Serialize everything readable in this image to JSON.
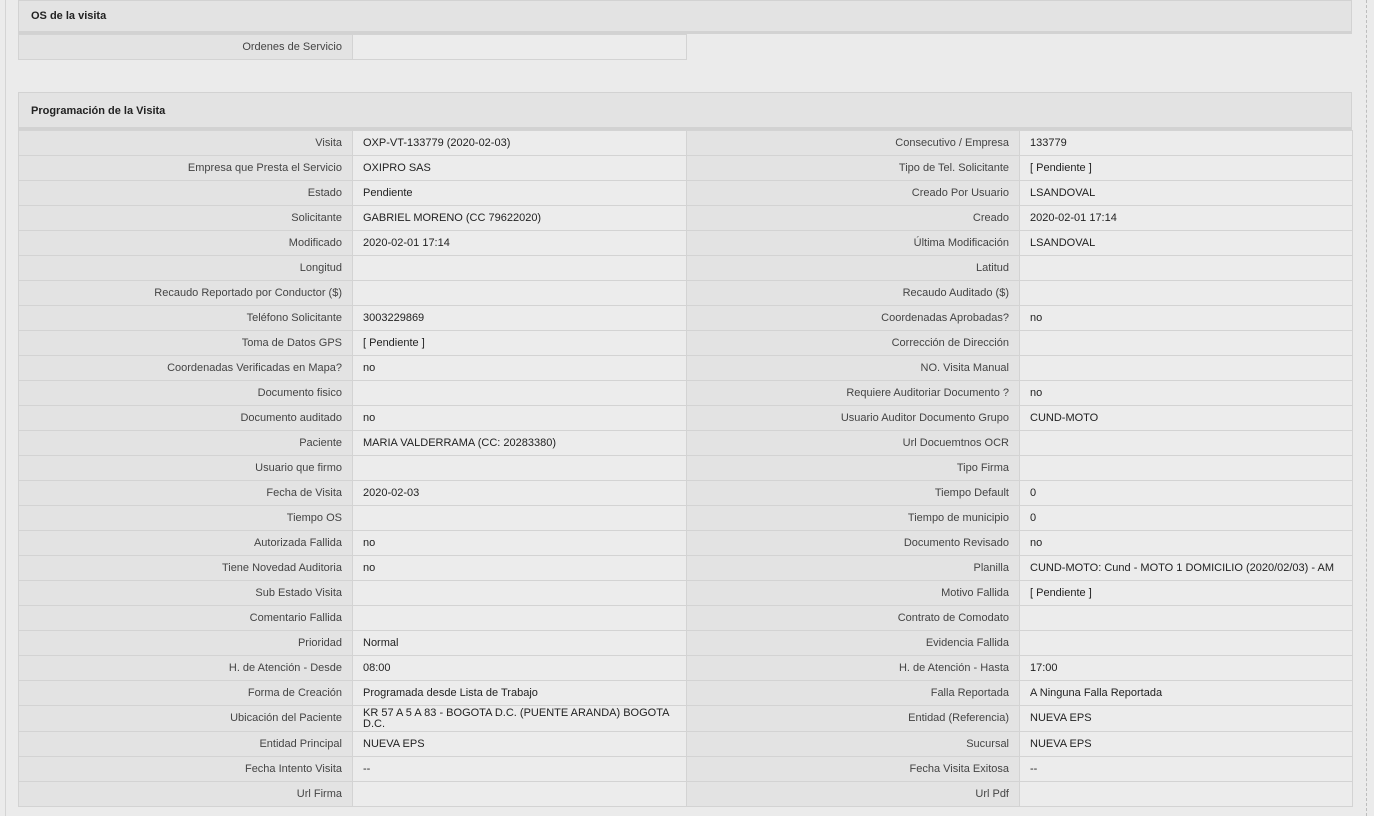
{
  "os_section": {
    "title": "OS de la visita",
    "rows": [
      {
        "label": "Ordenes de Servicio",
        "value": ""
      }
    ]
  },
  "program_section": {
    "title": "Programación de la Visita",
    "rows": [
      {
        "l1": "Visita",
        "v1": "OXP-VT-133779 (2020-02-03)",
        "l2": "Consecutivo / Empresa",
        "v2": "133779"
      },
      {
        "l1": "Empresa que Presta el Servicio",
        "v1": "OXIPRO SAS",
        "l2": "Tipo de Tel. Solicitante",
        "v2": "[ Pendiente ]"
      },
      {
        "l1": "Estado",
        "v1": "Pendiente",
        "l2": "Creado Por Usuario",
        "v2": "LSANDOVAL"
      },
      {
        "l1": "Solicitante",
        "v1": "GABRIEL MORENO (CC 79622020)",
        "l2": "Creado",
        "v2": "2020-02-01 17:14"
      },
      {
        "l1": "Modificado",
        "v1": "2020-02-01 17:14",
        "l2": "Última Modificación",
        "v2": " LSANDOVAL"
      },
      {
        "l1": "Longitud",
        "v1": "",
        "l2": "Latitud",
        "v2": ""
      },
      {
        "l1": "Recaudo Reportado por Conductor ($)",
        "v1": "",
        "l2": "Recaudo Auditado ($)",
        "v2": ""
      },
      {
        "l1": "Teléfono Solicitante",
        "v1": "3003229869",
        "l2": "Coordenadas Aprobadas?",
        "v2": " no"
      },
      {
        "l1": "Toma de Datos GPS",
        "v1": "[ Pendiente ]",
        "l2": "Corrección de Dirección",
        "v2": ""
      },
      {
        "l1": "Coordenadas Verificadas en Mapa?",
        "v1": " no",
        "l2": "NO. Visita Manual",
        "v2": ""
      },
      {
        "l1": "Documento fisico",
        "v1": "",
        "l2": "Requiere Auditoriar Documento ?",
        "v2": " no"
      },
      {
        "l1": "Documento auditado",
        "v1": " no",
        "l2": "Usuario Auditor Documento Grupo",
        "v2": "CUND-MOTO"
      },
      {
        "l1": "Paciente",
        "v1": "MARIA VALDERRAMA (CC: 20283380)",
        "l2": "Url Docuemtnos OCR",
        "v2": ""
      },
      {
        "l1": "Usuario que firmo",
        "v1": "",
        "l2": "Tipo Firma",
        "v2": ""
      },
      {
        "l1": "Fecha de Visita",
        "v1": " 2020-02-03",
        "l2": "Tiempo Default",
        "v2": "0"
      },
      {
        "l1": "Tiempo OS",
        "v1": "",
        "l2": "Tiempo de municipio",
        "v2": "0"
      },
      {
        "l1": "Autorizada Fallida",
        "v1": " no",
        "l2": "Documento Revisado",
        "v2": " no"
      },
      {
        "l1": "Tiene Novedad Auditoria",
        "v1": " no",
        "l2": "Planilla",
        "v2": "CUND-MOTO: Cund - MOTO 1 DOMICILIO (2020/02/03) - AM"
      },
      {
        "l1": "Sub Estado Visita",
        "v1": "",
        "l2": "Motivo Fallida",
        "v2": "[ Pendiente ]"
      },
      {
        "l1": "Comentario Fallida",
        "v1": "",
        "l2": "Contrato de Comodato",
        "v2": ""
      },
      {
        "l1": "Prioridad",
        "v1": "Normal",
        "l2": "Evidencia Fallida",
        "v2": ""
      },
      {
        "l1": "H. de Atención - Desde",
        "v1": "08:00",
        "l2": "H. de Atención - Hasta",
        "v2": "17:00"
      },
      {
        "l1": "Forma de Creación",
        "v1": "Programada desde Lista de Trabajo",
        "l2": "Falla Reportada",
        "v2": "A Ninguna Falla Reportada"
      },
      {
        "l1": "Ubicación del Paciente",
        "v1": "KR 57 A 5 A 83 - BOGOTA D.C. (PUENTE ARANDA) BOGOTA D.C.",
        "l2": "Entidad (Referencia)",
        "v2": "NUEVA EPS"
      },
      {
        "l1": "Entidad Principal",
        "v1": "NUEVA EPS",
        "l2": "Sucursal",
        "v2": "NUEVA EPS"
      },
      {
        "l1": "Fecha Intento Visita",
        "v1": " --",
        "l2": "Fecha Visita Exitosa",
        "v2": " --"
      },
      {
        "l1": "Url Firma",
        "v1": "",
        "l2": "Url Pdf",
        "v2": ""
      }
    ]
  }
}
